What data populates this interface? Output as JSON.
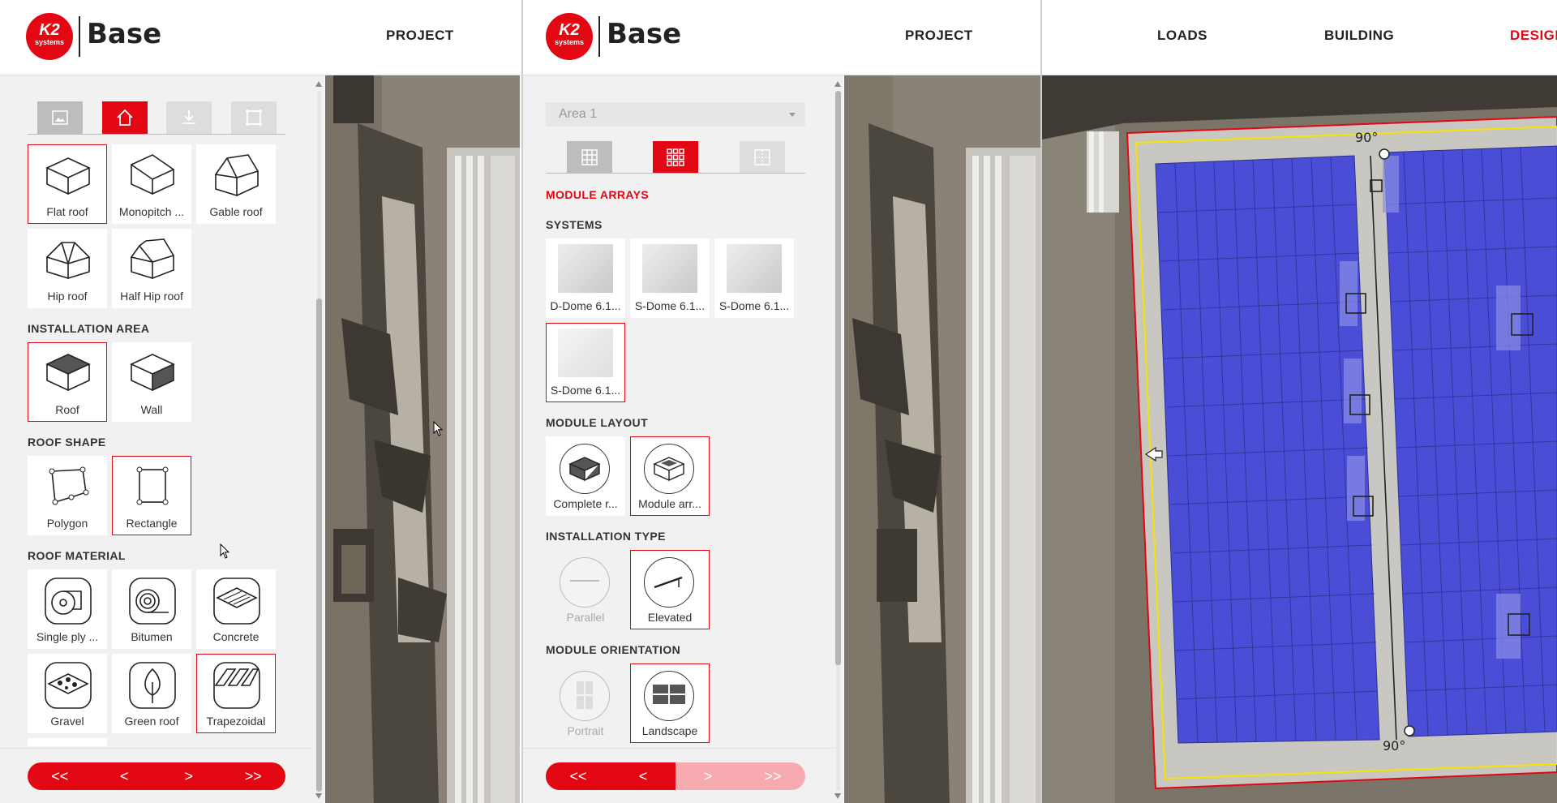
{
  "panel1": {
    "brand": "Base",
    "logo_k2": "K2",
    "logo_sub": "systems",
    "nav_project": "PROJECT",
    "tabs": [
      {
        "icon": "image-icon",
        "selected": false
      },
      {
        "icon": "house-icon",
        "selected": true
      },
      {
        "icon": "download-icon",
        "selected": false
      },
      {
        "icon": "frame-icon",
        "selected": false
      }
    ],
    "roof_types": [
      {
        "label": "Flat roof",
        "selected": true
      },
      {
        "label": "Monopitch ...",
        "selected": false
      },
      {
        "label": "Gable roof",
        "selected": false
      },
      {
        "label": "Hip roof",
        "selected": false
      },
      {
        "label": "Half Hip roof",
        "selected": false
      }
    ],
    "installation_area": {
      "title": "INSTALLATION AREA",
      "items": [
        {
          "label": "Roof",
          "selected": true
        },
        {
          "label": "Wall",
          "selected": false
        }
      ]
    },
    "roof_shape": {
      "title": "ROOF SHAPE",
      "items": [
        {
          "label": "Polygon",
          "selected": false
        },
        {
          "label": "Rectangle",
          "selected": true
        }
      ]
    },
    "roof_material": {
      "title": "ROOF MATERIAL",
      "items": [
        {
          "label": "Single ply ...",
          "selected": false
        },
        {
          "label": "Bitumen",
          "selected": false
        },
        {
          "label": "Concrete",
          "selected": false
        },
        {
          "label": "Gravel",
          "selected": false
        },
        {
          "label": "Green roof",
          "selected": false
        },
        {
          "label": "Trapezoidal",
          "selected": true
        }
      ]
    },
    "pager": [
      "<<",
      "<",
      ">",
      ">>"
    ]
  },
  "panel2": {
    "brand": "Base",
    "logo_k2": "K2",
    "logo_sub": "systems",
    "nav_project": "PROJECT",
    "area_select": "Area 1",
    "tabs": [
      {
        "icon": "grid-icon",
        "selected": false
      },
      {
        "icon": "module-grid-icon",
        "selected": true
      },
      {
        "icon": "split-grid-icon",
        "selected": false
      }
    ],
    "module_arrays_title": "MODULE ARRAYS",
    "systems": {
      "title": "SYSTEMS",
      "items": [
        {
          "label": "D-Dome 6.1...",
          "selected": false
        },
        {
          "label": "S-Dome 6.1...",
          "selected": false
        },
        {
          "label": "S-Dome 6.1...",
          "selected": false
        },
        {
          "label": "S-Dome 6.1...",
          "selected": true
        }
      ]
    },
    "module_layout": {
      "title": "MODULE LAYOUT",
      "items": [
        {
          "label": "Complete r...",
          "selected": false
        },
        {
          "label": "Module arr...",
          "selected": true
        }
      ]
    },
    "installation_type": {
      "title": "INSTALLATION TYPE",
      "items": [
        {
          "label": "Parallel",
          "selected": false,
          "disabled": true
        },
        {
          "label": "Elevated",
          "selected": true
        }
      ]
    },
    "module_orientation": {
      "title": "MODULE ORIENTATION",
      "items": [
        {
          "label": "Portrait",
          "selected": false,
          "disabled": true
        },
        {
          "label": "Landscape",
          "selected": true
        }
      ]
    },
    "pager": [
      "<<",
      "<",
      ">",
      ">>"
    ]
  },
  "panel3": {
    "nav_loads": "LOADS",
    "nav_building": "BUILDING",
    "nav_design": "DESIGN",
    "angle_top": "90°",
    "angle_bottom": "90°"
  },
  "colors": {
    "accent": "#e30613",
    "module_blue": "#4a4ed6",
    "outline_yellow": "#f5e400"
  }
}
